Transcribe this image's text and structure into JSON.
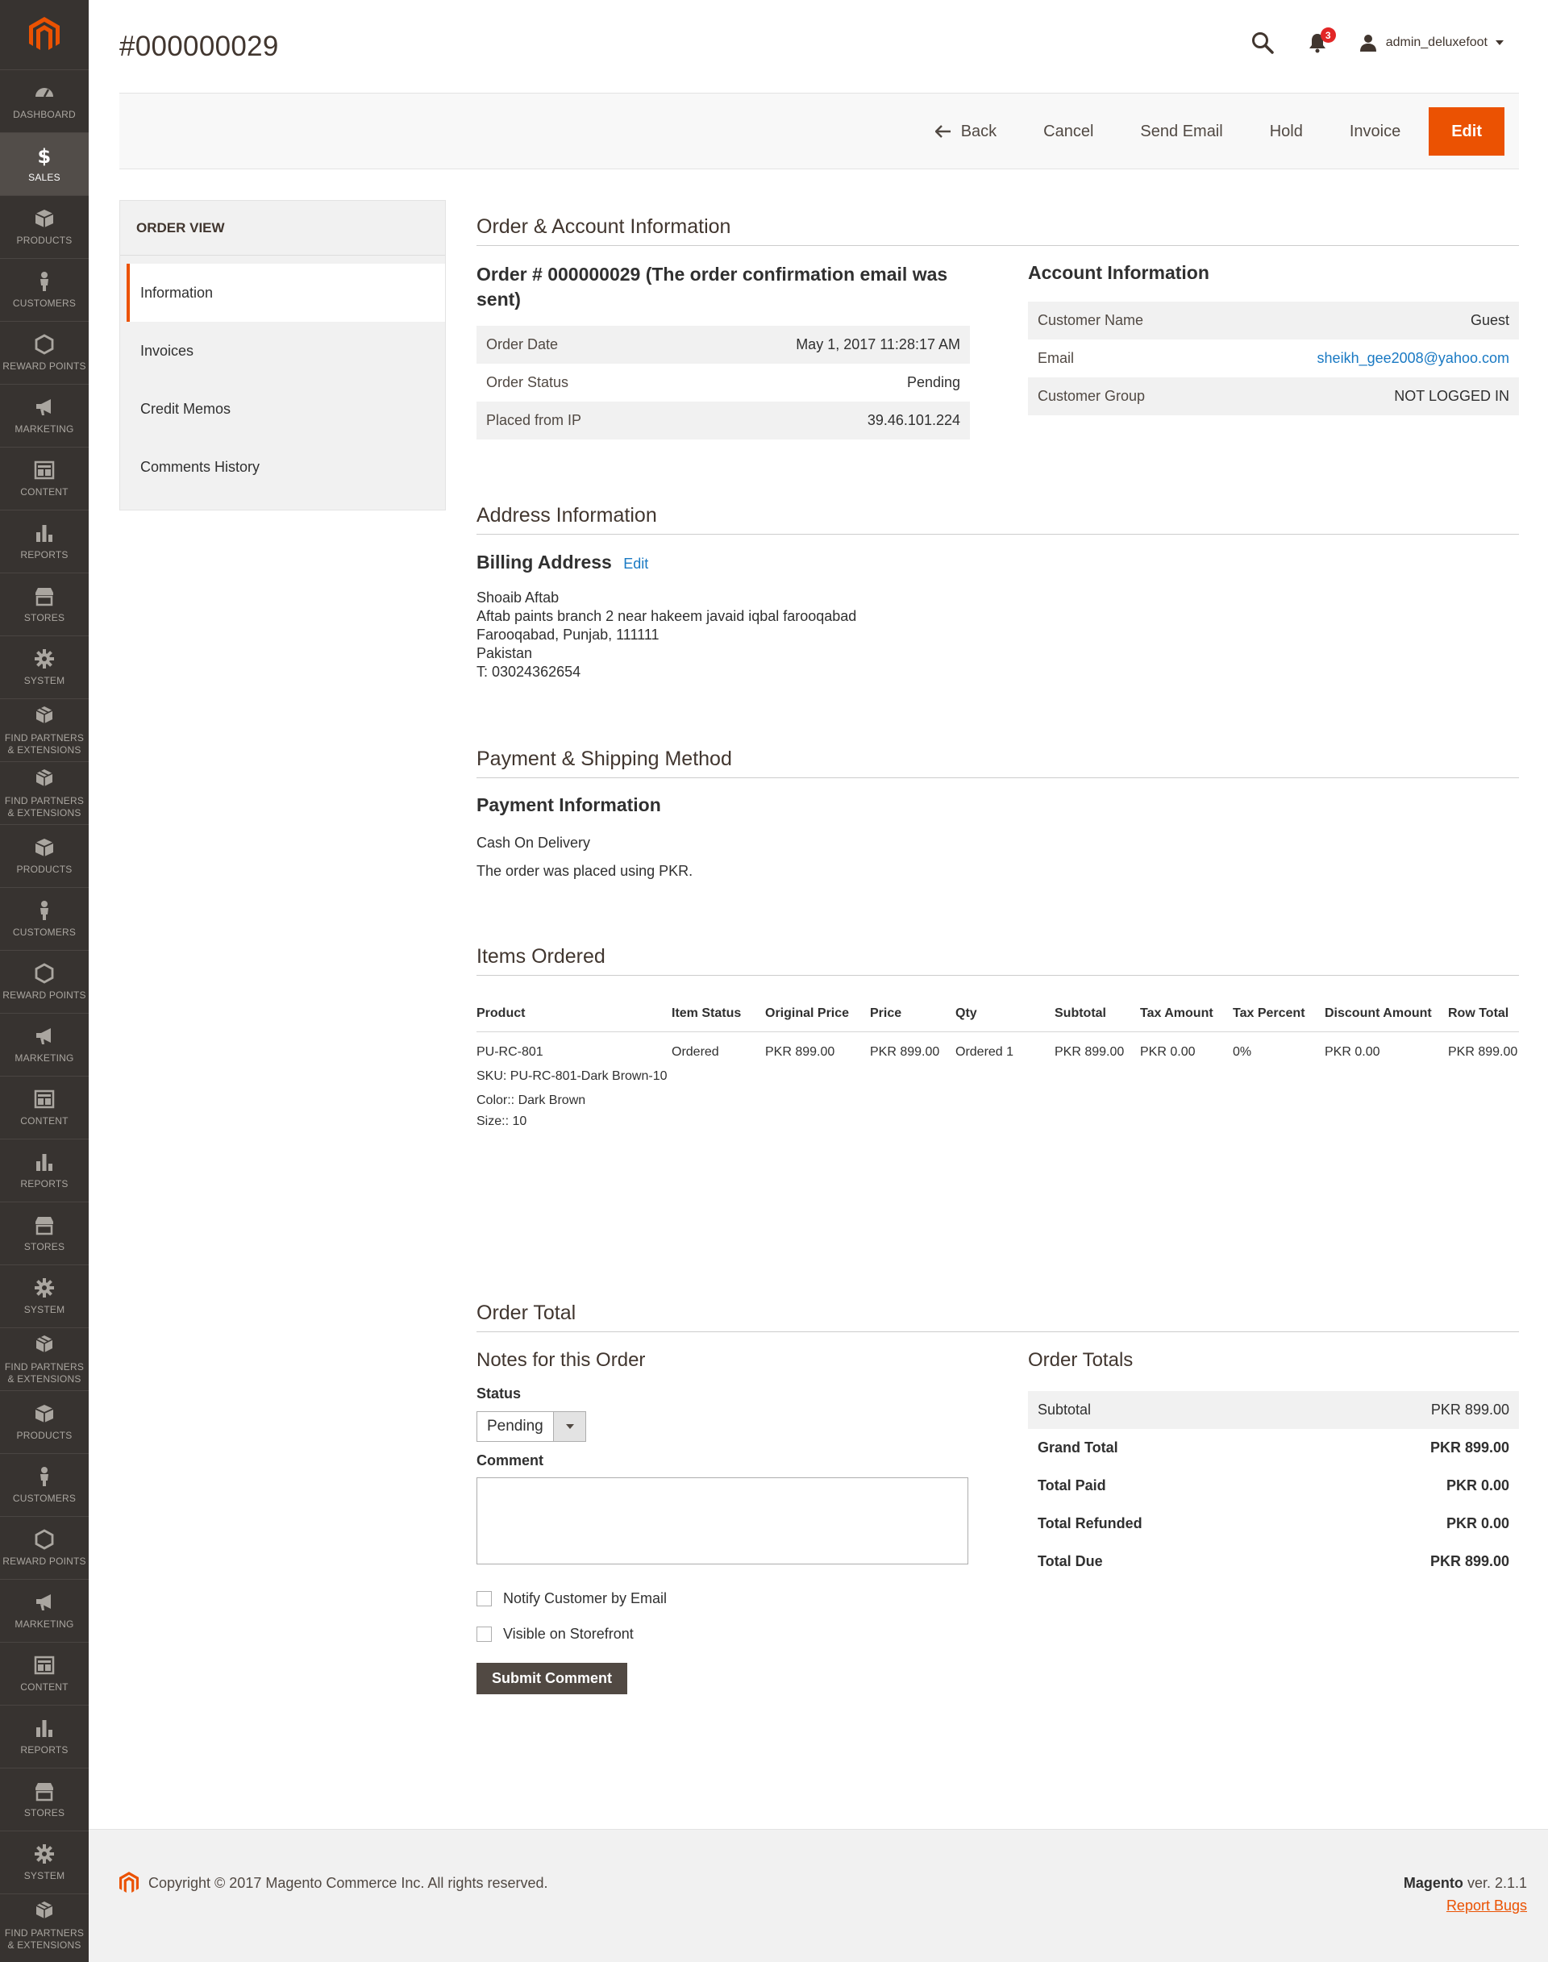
{
  "page_title": "#000000029",
  "colors": {
    "accent": "#eb5202",
    "sidebar": "#373330",
    "link": "#1979c3"
  },
  "sidebar": {
    "items": [
      {
        "label": "DASHBOARD",
        "icon": "dashboard-icon"
      },
      {
        "label": "SALES",
        "icon": "dollar-icon"
      },
      {
        "label": "PRODUCTS",
        "icon": "cube-icon"
      },
      {
        "label": "CUSTOMERS",
        "icon": "person-icon"
      },
      {
        "label": "REWARD POINTS",
        "icon": "hexagon-icon"
      },
      {
        "label": "MARKETING",
        "icon": "megaphone-icon"
      },
      {
        "label": "CONTENT",
        "icon": "layout-icon"
      },
      {
        "label": "REPORTS",
        "icon": "bar-chart-icon"
      },
      {
        "label": "STORES",
        "icon": "storefront-icon"
      },
      {
        "label": "SYSTEM",
        "icon": "gear-icon"
      },
      {
        "label": "FIND PARTNERS & EXTENSIONS",
        "icon": "boxes-icon"
      },
      {
        "label": "FIND PARTNERS & EXTENSIONS",
        "icon": "boxes-icon"
      },
      {
        "label": "PRODUCTS",
        "icon": "cube-icon"
      },
      {
        "label": "CUSTOMERS",
        "icon": "person-icon"
      },
      {
        "label": "REWARD POINTS",
        "icon": "hexagon-icon"
      },
      {
        "label": "MARKETING",
        "icon": "megaphone-icon"
      },
      {
        "label": "CONTENT",
        "icon": "layout-icon"
      },
      {
        "label": "REPORTS",
        "icon": "bar-chart-icon"
      },
      {
        "label": "STORES",
        "icon": "storefront-icon"
      },
      {
        "label": "SYSTEM",
        "icon": "gear-icon"
      },
      {
        "label": "FIND PARTNERS & EXTENSIONS",
        "icon": "boxes-icon"
      },
      {
        "label": "PRODUCTS",
        "icon": "cube-icon"
      },
      {
        "label": "CUSTOMERS",
        "icon": "person-icon"
      },
      {
        "label": "REWARD POINTS",
        "icon": "hexagon-icon"
      },
      {
        "label": "MARKETING",
        "icon": "megaphone-icon"
      },
      {
        "label": "CONTENT",
        "icon": "layout-icon"
      },
      {
        "label": "REPORTS",
        "icon": "bar-chart-icon"
      },
      {
        "label": "STORES",
        "icon": "storefront-icon"
      },
      {
        "label": "SYSTEM",
        "icon": "gear-icon"
      },
      {
        "label": "FIND PARTNERS & EXTENSIONS",
        "icon": "boxes-icon"
      }
    ]
  },
  "header": {
    "notifications_count": "3",
    "username": "admin_deluxefoot"
  },
  "actions": {
    "back": "Back",
    "cancel": "Cancel",
    "send_email": "Send Email",
    "hold": "Hold",
    "invoice": "Invoice",
    "edit": "Edit"
  },
  "tabs": {
    "title": "ORDER VIEW",
    "items": [
      "Information",
      "Invoices",
      "Credit Memos",
      "Comments History"
    ]
  },
  "order_account": {
    "section_title": "Order & Account Information",
    "order_heading": "Order # 000000029 (The order confirmation email was sent)",
    "order_rows": [
      {
        "label": "Order Date",
        "value": "May 1, 2017 11:28:17 AM"
      },
      {
        "label": "Order Status",
        "value": "Pending"
      },
      {
        "label": "Placed from IP",
        "value": "39.46.101.224"
      }
    ],
    "account_heading": "Account Information",
    "account_rows": [
      {
        "label": "Customer Name",
        "value": "Guest"
      },
      {
        "label": "Email",
        "value": "sheikh_gee2008@yahoo.com"
      },
      {
        "label": "Customer Group",
        "value": "NOT LOGGED IN"
      }
    ]
  },
  "address": {
    "section_title": "Address Information",
    "billing_heading": "Billing Address",
    "edit_link": "Edit",
    "lines": [
      "Shoaib Aftab",
      "Aftab paints branch 2 near hakeem javaid iqbal farooqabad",
      "Farooqabad, Punjab, 111111",
      "Pakistan",
      "T: 03024362654"
    ]
  },
  "payment": {
    "section_title": "Payment & Shipping Method",
    "heading": "Payment Information",
    "method": "Cash On Delivery",
    "currency_note": "The order was placed using PKR."
  },
  "items": {
    "section_title": "Items Ordered",
    "columns": [
      "Product",
      "Item Status",
      "Original Price",
      "Price",
      "Qty",
      "Subtotal",
      "Tax Amount",
      "Tax Percent",
      "Discount Amount",
      "Row Total"
    ],
    "rows": [
      {
        "product": "PU-RC-801",
        "sku": "SKU: PU-RC-801-Dark Brown-10",
        "color": "Color:: Dark Brown",
        "size": "Size:: 10",
        "item_status": "Ordered",
        "original_price": "PKR 899.00",
        "price": "PKR 899.00",
        "qty": "Ordered  1",
        "subtotal": "PKR 899.00",
        "tax_amount": "PKR 0.00",
        "tax_percent": "0%",
        "discount_amount": "PKR 0.00",
        "row_total": "PKR 899.00"
      }
    ]
  },
  "order_total": {
    "section_title": "Order Total",
    "notes_heading": "Notes for this Order",
    "status_label": "Status",
    "status_value": "Pending",
    "comment_label": "Comment",
    "notify_label": "Notify Customer by Email",
    "visible_label": "Visible on Storefront",
    "submit_label": "Submit Comment",
    "totals_heading": "Order Totals",
    "totals": [
      {
        "label": "Subtotal",
        "value": "PKR 899.00"
      },
      {
        "label": "Grand Total",
        "value": "PKR 899.00"
      },
      {
        "label": "Total Paid",
        "value": "PKR 0.00"
      },
      {
        "label": "Total Refunded",
        "value": "PKR 0.00"
      },
      {
        "label": "Total Due",
        "value": "PKR 899.00"
      }
    ]
  },
  "footer": {
    "copyright": "Copyright © 2017 Magento Commerce Inc. All rights reserved.",
    "brand": "Magento",
    "version": "ver. 2.1.1",
    "report_bugs": "Report Bugs"
  }
}
